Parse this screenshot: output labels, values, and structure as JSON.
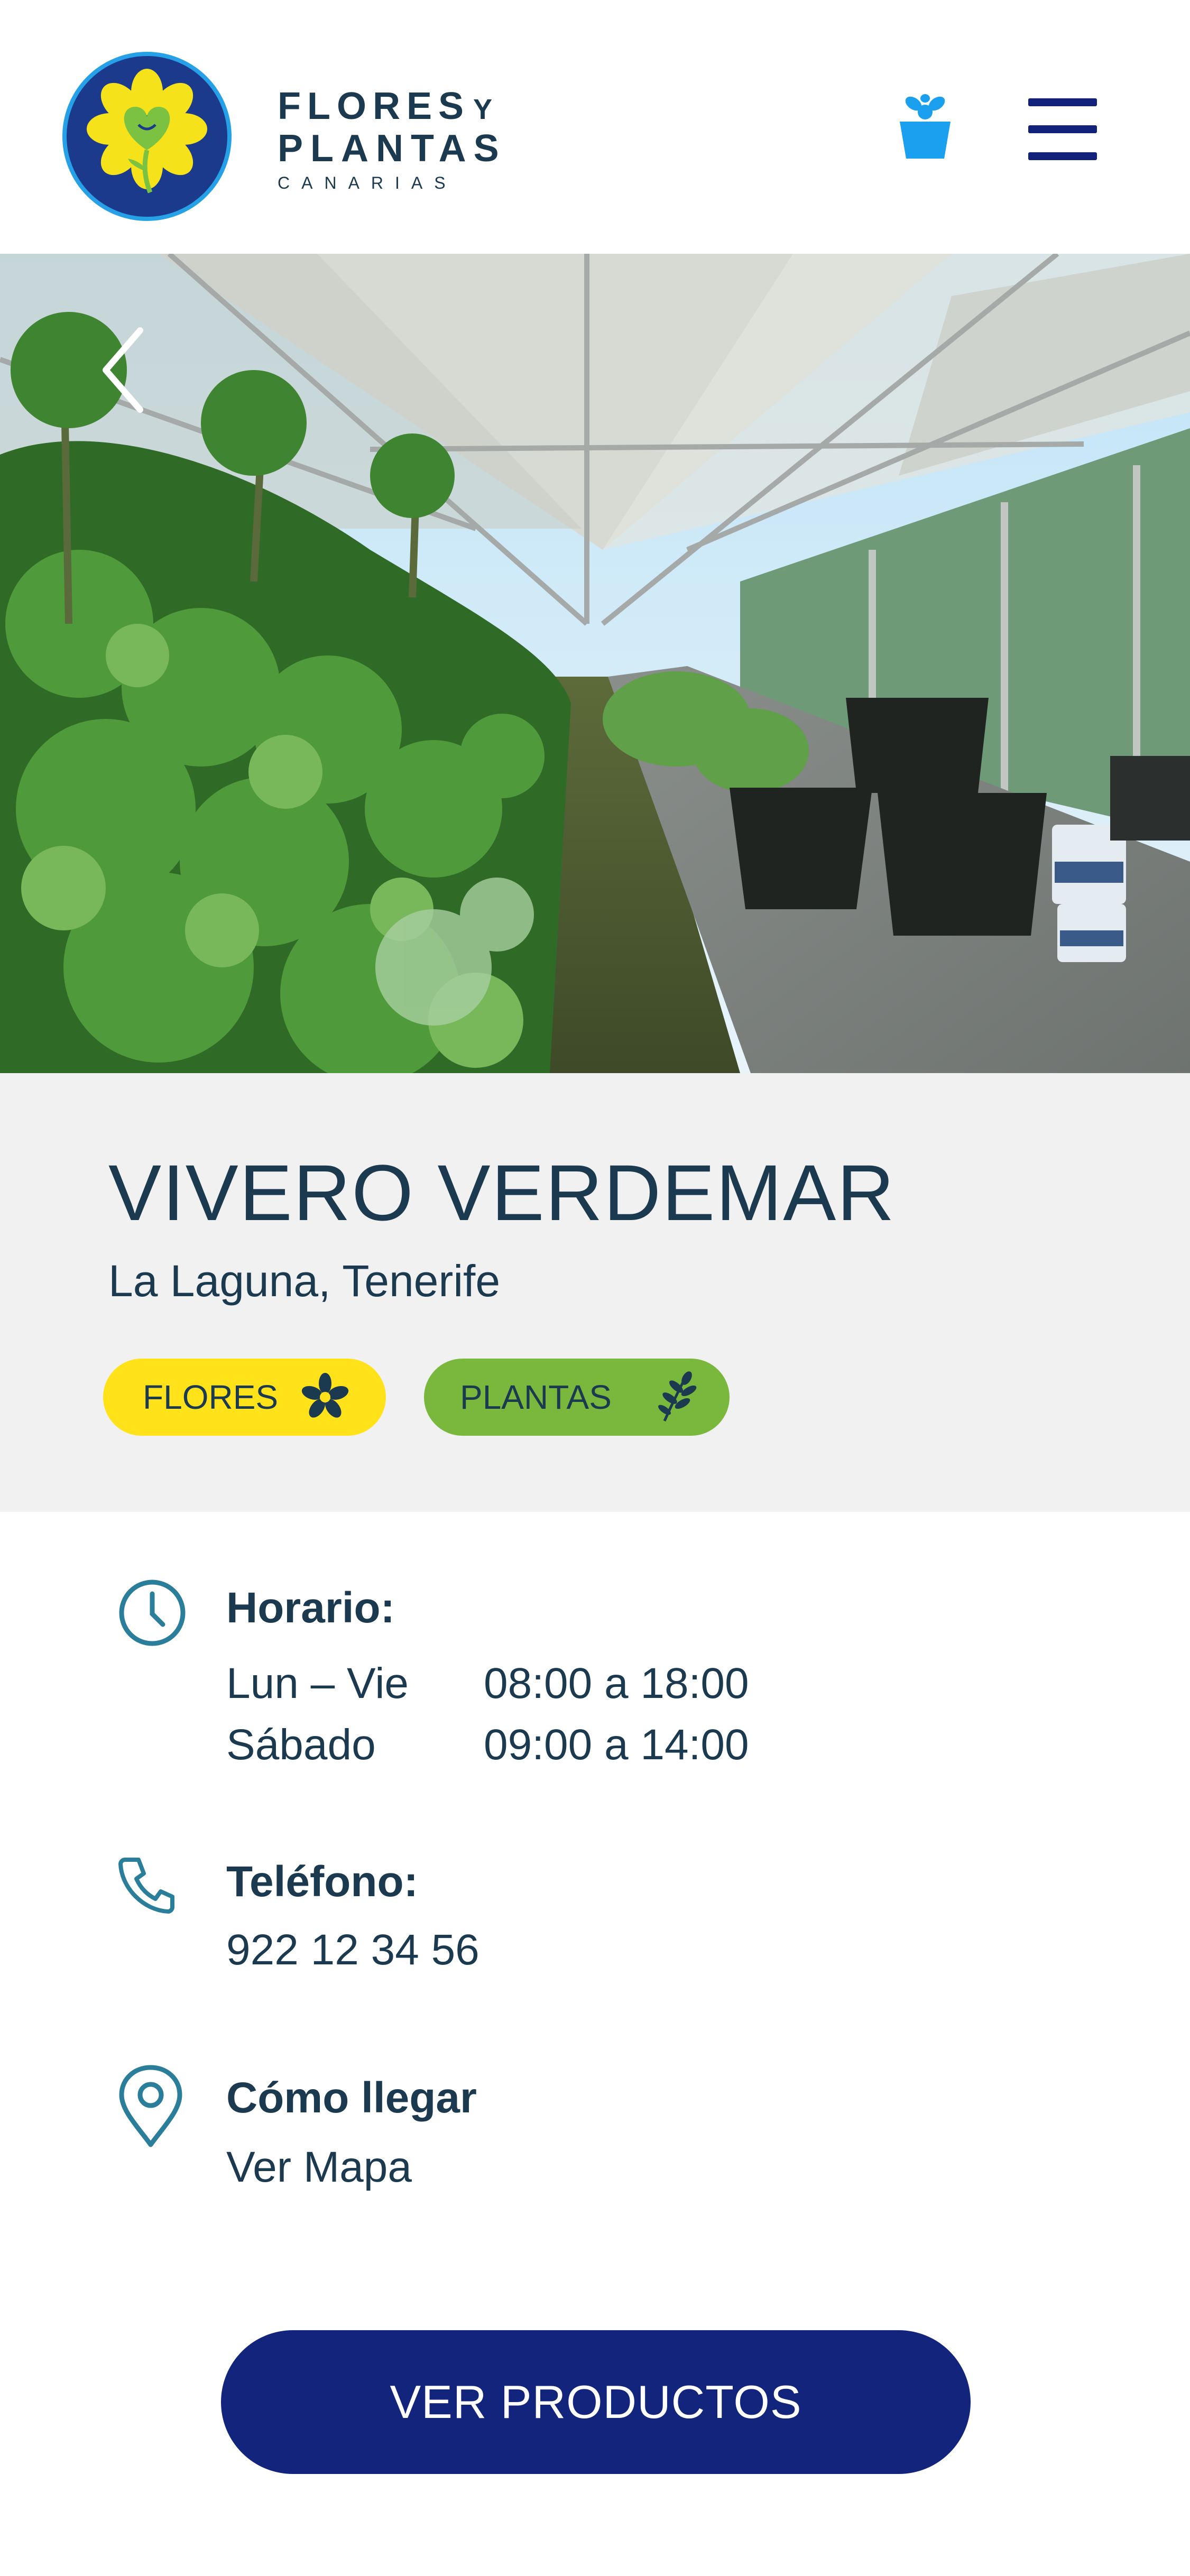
{
  "header": {
    "brand_line1": "FLORES",
    "brand_y": "Y",
    "brand_line2": "PLANTAS",
    "brand_line3": "CANARIAS",
    "icons": [
      "logo-flower-heart",
      "flower-pot-icon",
      "hamburger-menu-icon"
    ]
  },
  "hero": {
    "alt": "greenhouse",
    "back_icon": "chevron-left-icon"
  },
  "nursery": {
    "name": "VIVERO VERDEMAR",
    "location": "La Laguna, Tenerife",
    "tags": [
      {
        "label": "FLORES",
        "icon": "flower-icon",
        "color": "#ffe21a"
      },
      {
        "label": "PLANTAS",
        "icon": "leaf-branch-icon",
        "color": "#79b83d"
      }
    ]
  },
  "schedule": {
    "label": "Horario:",
    "rows": [
      {
        "days": "Lun – Vie",
        "hours": "08:00 a 18:00"
      },
      {
        "days": "Sábado",
        "hours": "09:00 a 14:00"
      }
    ]
  },
  "phone": {
    "label": "Teléfono:",
    "value": "922 12 34 56"
  },
  "directions": {
    "label": "Cómo llegar",
    "link": "Ver Mapa"
  },
  "cta": {
    "label": "VER PRODUCTOS"
  },
  "colors": {
    "navy": "#13247c",
    "text": "#1c3a4f",
    "accent_icon": "#2a7e9a",
    "flores_tag": "#ffe21a",
    "plantas_tag": "#79b83d",
    "pot_icon": "#1aa0ef"
  }
}
